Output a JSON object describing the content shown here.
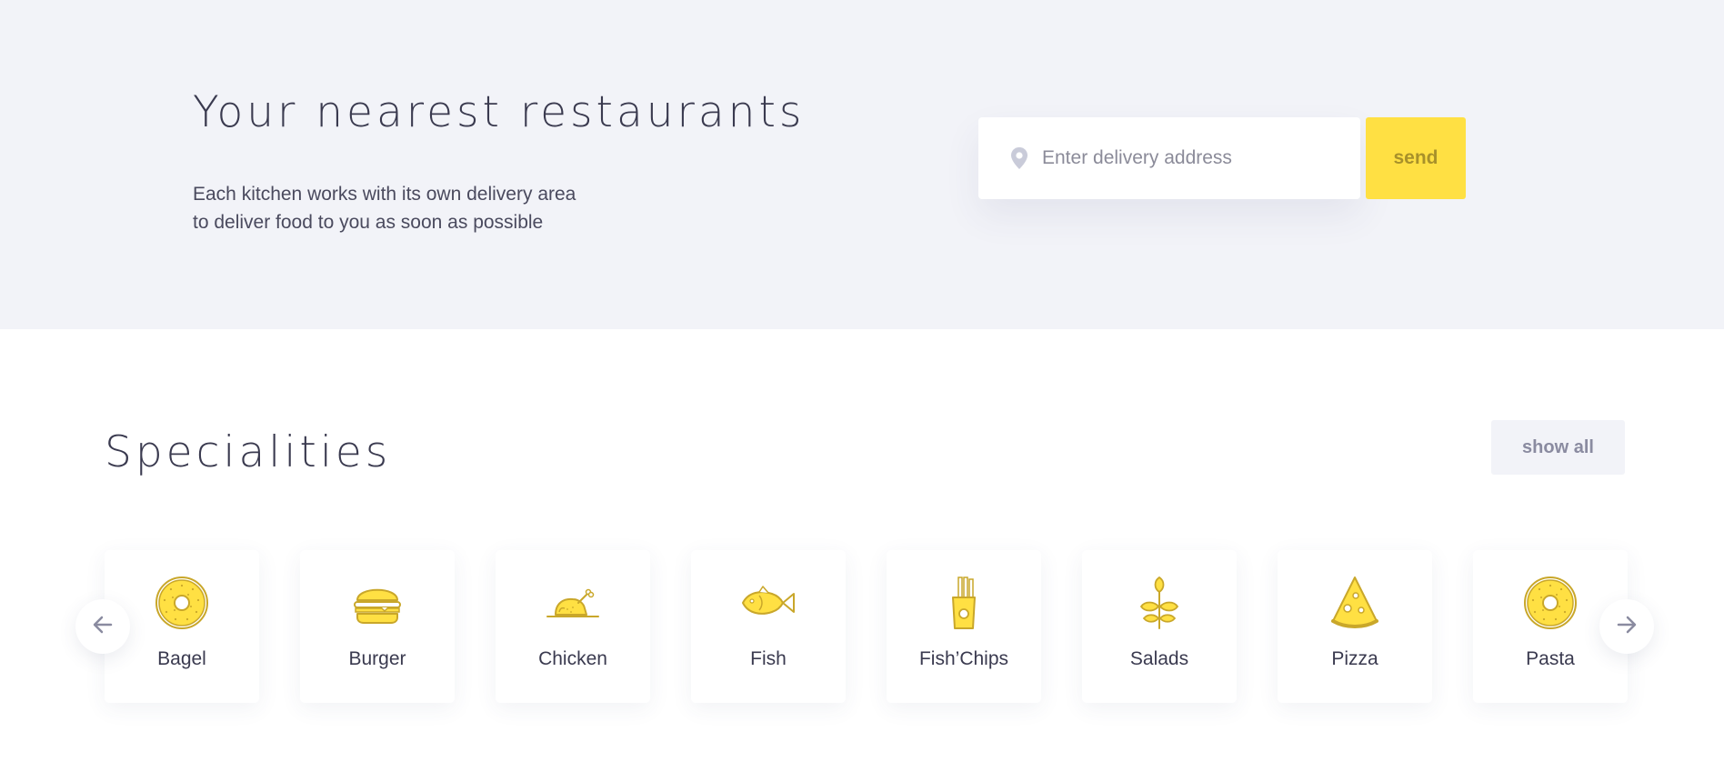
{
  "hero": {
    "title": "Your nearest restaurants",
    "subtitle_line1": "Each kitchen works with its own delivery area",
    "subtitle_line2": "to deliver food to you as soon as possible",
    "address_placeholder": "Enter delivery address",
    "address_value": "",
    "send_label": "send",
    "icon": "location-pin-icon"
  },
  "specialities": {
    "title": "Specialities",
    "show_all_label": "show all",
    "prev_icon": "arrow-left-icon",
    "next_icon": "arrow-right-icon",
    "items": [
      {
        "label": "Bagel",
        "icon": "bagel-icon"
      },
      {
        "label": "Burger",
        "icon": "burger-icon"
      },
      {
        "label": "Chicken",
        "icon": "chicken-icon"
      },
      {
        "label": "Fish",
        "icon": "fish-icon"
      },
      {
        "label": "Fish’Chips",
        "icon": "fries-icon"
      },
      {
        "label": "Salads",
        "icon": "salad-icon"
      },
      {
        "label": "Pizza",
        "icon": "pizza-icon"
      },
      {
        "label": "Pasta",
        "icon": "bagel-icon"
      }
    ]
  },
  "colors": {
    "accent": "#ffe043",
    "icon_stroke": "#c9a72a",
    "hero_background": "#f2f3f8",
    "heading_text": "#3a3a4f",
    "muted_button_text": "#8a8ba0"
  }
}
